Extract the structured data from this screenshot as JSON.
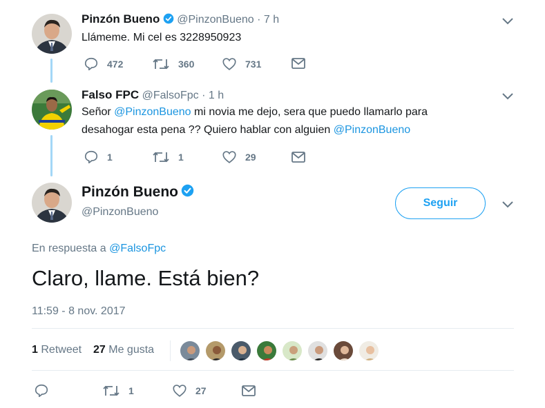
{
  "tweet1": {
    "name": "Pinzón Bueno",
    "handle": "@PinzonBueno",
    "time": "· 7 h",
    "text": "Llámeme. Mi cel es 3228950923",
    "replies": "472",
    "retweets": "360",
    "likes": "731"
  },
  "tweet2": {
    "name": "Falso FPC",
    "handle": "@FalsoFpc",
    "time": "· 1 h",
    "text_1": "Señor ",
    "mention_1": "@PinzonBueno",
    "text_2": " mi novia me dejo, sera que puedo llamarlo para",
    "text_3": "desahogar esta pena ?? Quiero hablar con alguien ",
    "mention_2": "@PinzonBueno",
    "replies": "1",
    "retweets": "1",
    "likes": "29"
  },
  "main": {
    "name": "Pinzón Bueno",
    "handle": "@PinzonBueno",
    "follow_label": "Seguir",
    "reply_prefix": "En respuesta a ",
    "reply_to": "@FalsoFpc",
    "text": "Claro, llame. Está bien?",
    "timestamp": "11:59 - 8 nov. 2017",
    "retweet_count": "1",
    "retweet_label": "Retweet",
    "like_count": "27",
    "like_label": "Me gusta",
    "retweets": "1",
    "likes": "27"
  },
  "icons": {
    "verified": "verified-badge-icon",
    "reply": "reply-icon",
    "retweet": "retweet-icon",
    "like": "heart-icon",
    "dm": "envelope-icon",
    "more": "chevron-down-icon"
  },
  "colors": {
    "accent": "#1da1f2",
    "mention": "#1b95e0",
    "secondary_text": "#657786",
    "thread_line": "#a3d7f7"
  }
}
